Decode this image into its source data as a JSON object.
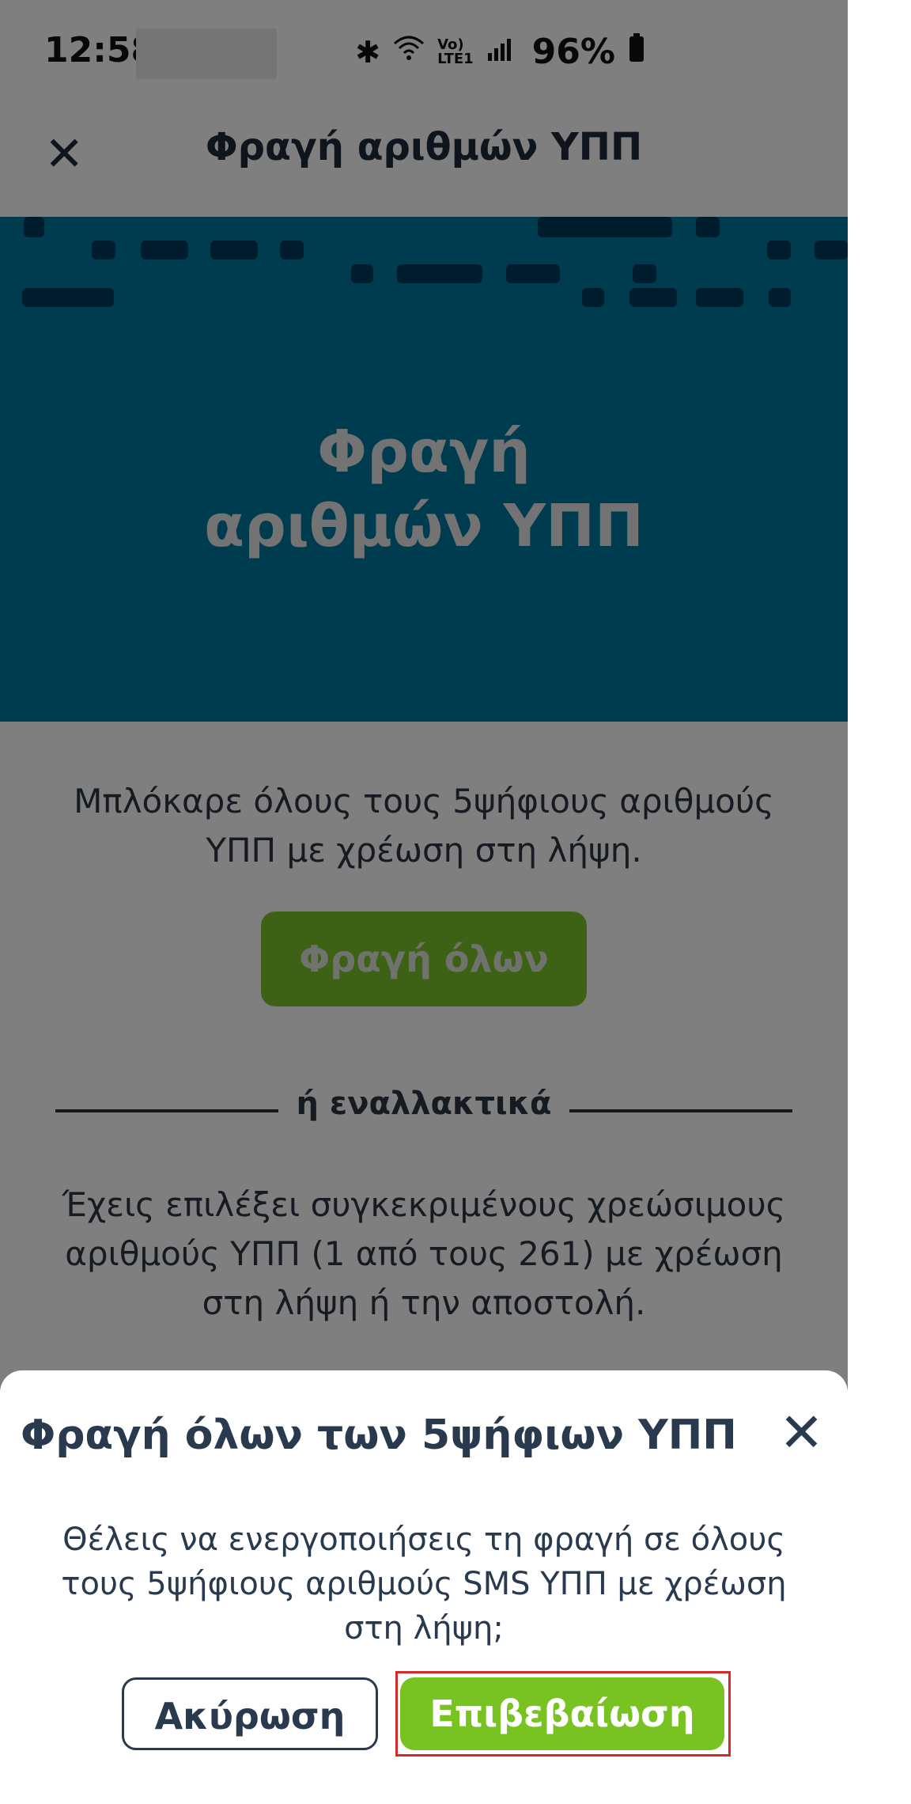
{
  "status_bar": {
    "time": "12:58",
    "battery": "96%"
  },
  "app_bar": {
    "title": "Φραγή αριθμών ΥΠΠ"
  },
  "hero": {
    "title_line1": "Φραγή",
    "title_line2": "αριθμών ΥΠΠ"
  },
  "content": {
    "intro": "Μπλόκαρε όλους τους 5ψήφιους αριθμούς ΥΠΠ με χρέωση στη λήψη.",
    "block_all_button": "Φραγή όλων",
    "divider": "ή εναλλακτικά",
    "selected_info": "Έχεις επιλέξει συγκεκριμένους χρεώσιμους αριθμούς ΥΠΠ (1 από τους 261) με χρέωση στη λήψη ή την αποστολή."
  },
  "dialog": {
    "title": "Φραγή όλων των 5ψήφιων ΥΠΠ",
    "message": "Θέλεις να ενεργοποιήσεις τη φραγή σε όλους τους 5ψήφιους αριθμούς SMS ΥΠΠ με χρέωση στη λήψη;",
    "cancel": "Ακύρωση",
    "confirm": "Επιβεβαίωση"
  },
  "colors": {
    "accent_green": "#78c221",
    "hero_blue": "#00799e",
    "text_dark": "#2a3a4e"
  }
}
